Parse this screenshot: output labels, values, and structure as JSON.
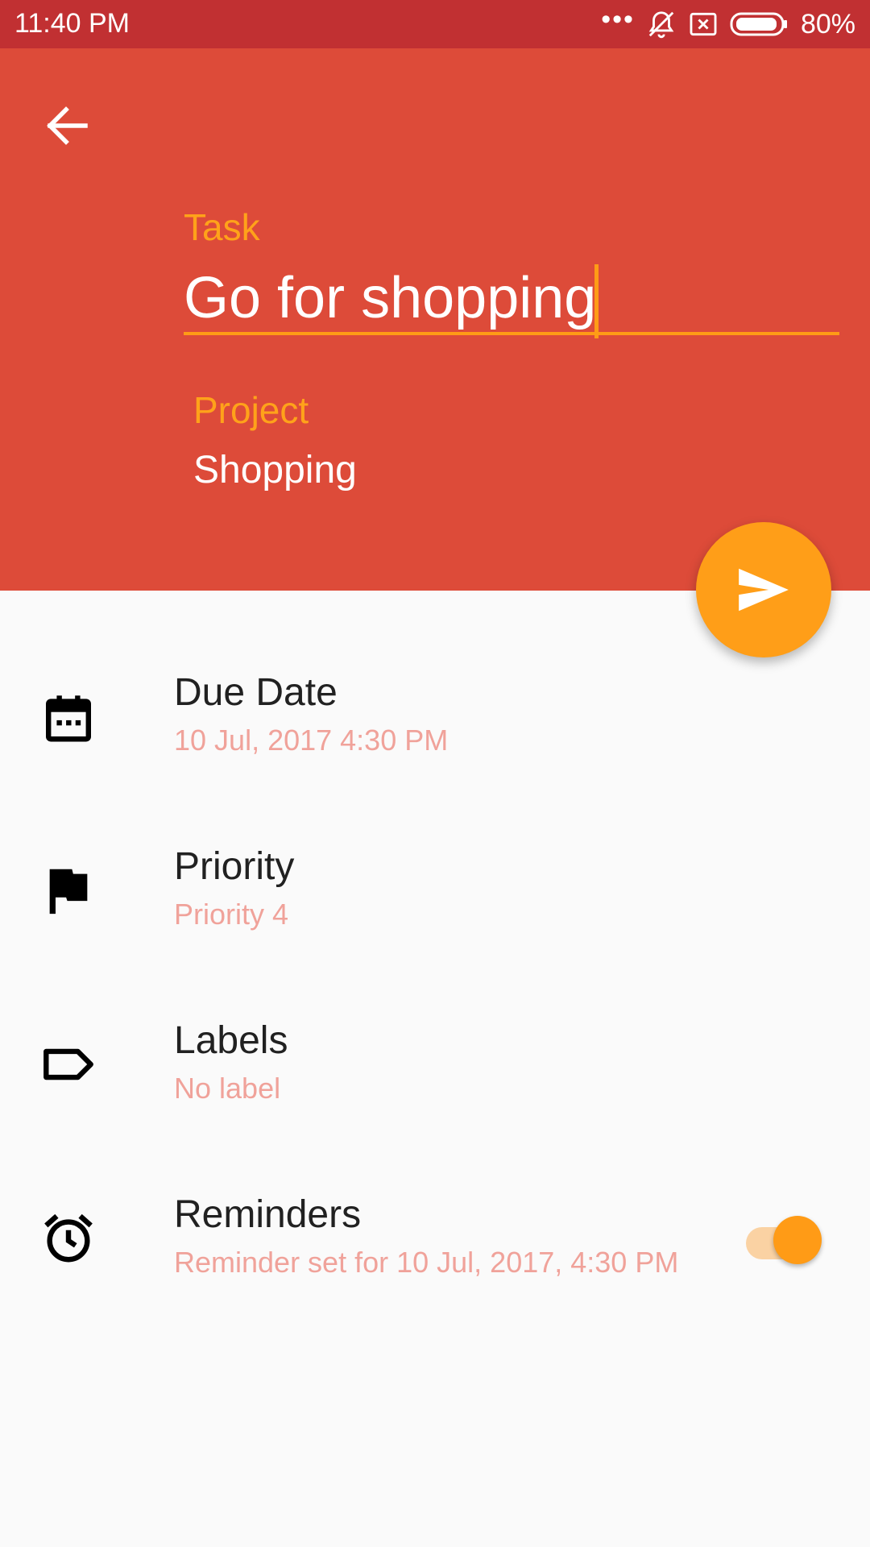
{
  "status_bar": {
    "time": "11:40 PM",
    "dots": "•••",
    "battery_text": "80%"
  },
  "header": {
    "task_label": "Task",
    "task_value": "Go for shopping",
    "project_label": "Project",
    "project_value": "Shopping"
  },
  "items": [
    {
      "title": "Due Date",
      "subtitle": "10 Jul, 2017 4:30 PM",
      "icon": "calendar-icon"
    },
    {
      "title": "Priority",
      "subtitle": "Priority 4",
      "icon": "flag-icon"
    },
    {
      "title": "Labels",
      "subtitle": "No label",
      "icon": "label-icon"
    },
    {
      "title": "Reminders",
      "subtitle": "Reminder set for 10 Jul, 2017, 4:30 PM",
      "icon": "alarm-icon",
      "toggle_on": true
    }
  ],
  "colors": {
    "status_bar": "#c13032",
    "header": "#dd4b39",
    "accent": "#ff9e18",
    "subtitle": "#f0a29a",
    "background": "#fafafa"
  }
}
